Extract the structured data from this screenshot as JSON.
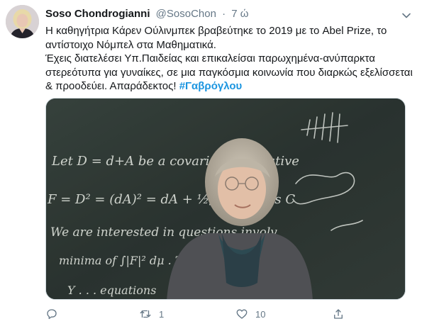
{
  "tweet": {
    "author_name": "Soso Chondrogianni",
    "author_handle": "@SosoChon",
    "separator": "·",
    "time": "7 ώ",
    "line1": "Η καθηγήτρια Κάρεν Ούλινμπεκ βραβεύτηκε το 2019 με το Abel Prize, το αντίστοιχο Νόμπελ στα Μαθηματικά.",
    "line2": "Έχεις διατελέσει Υπ.Παιδείας και επικαλείσαι παρωχημένα-ανύπαρκτα στερεότυπα για γυναίκες, σε μια παγκόσμια κοινωνία που διαρκώς εξελίσσεται & προοδεύει. Απαράδεκτος! ",
    "hashtag": "#Γαβρόγλου",
    "chalk_lines": [
      "Let D = d+A be a covariant derivative",
      "F = D² = (dA)² = dA + ½[A,A]  be its C",
      "We are interested in  questions  involv",
      "minima of  ∫|F|² dμ .  These are",
      "Y . . .  equations"
    ]
  },
  "actions": {
    "reply_count": "",
    "retweet_count": "1",
    "like_count": "10",
    "share_count": ""
  },
  "colors": {
    "link": "#1b95e0",
    "muted": "#657786",
    "chalkboard": "#2f3a35"
  },
  "icons": [
    "avatar-photo",
    "chevron-down-icon",
    "reply-icon",
    "retweet-icon",
    "heart-icon",
    "share-icon"
  ]
}
